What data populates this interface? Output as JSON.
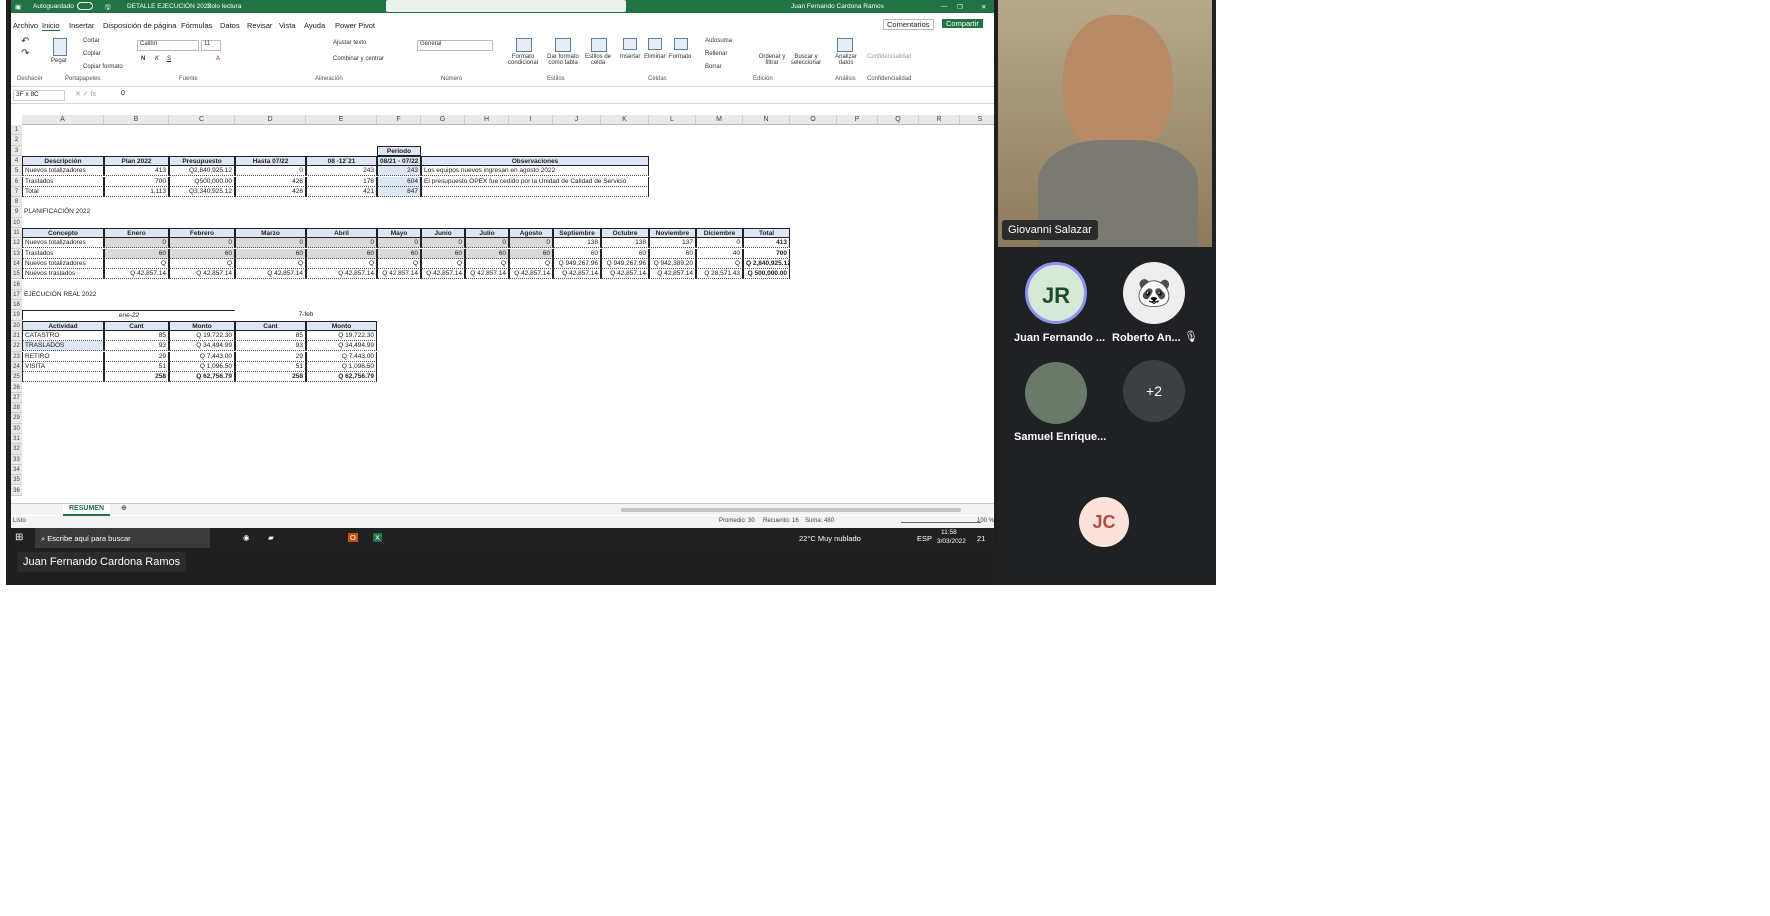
{
  "window": {
    "autosave": "Autoguardado",
    "file": "DETALLE EJECUCIÓN 2022",
    "mode": "Solo lectura",
    "user": "Juan Fernando Cardona Ramos"
  },
  "menu": [
    "Archivo",
    "Inicio",
    "Insertar",
    "Disposición de página",
    "Fórmulas",
    "Datos",
    "Revisar",
    "Vista",
    "Ayuda",
    "Power Pivot"
  ],
  "menu_right": {
    "comments": "Comentarios",
    "share": "Compartir"
  },
  "ribbon": {
    "cut": "Cortar",
    "copy": "Copiar",
    "paste": "Pegar",
    "format_painter": "Copiar formato",
    "font": "Calibri",
    "size": "11",
    "wrap": "Ajustar texto",
    "merge": "Combinar y centrar",
    "numformat": "General",
    "cond": "Formato condicional",
    "table": "Dar formato como tabla",
    "styles": "Estilos de celda",
    "insert": "Insertar",
    "delete": "Eliminar",
    "format": "Formato",
    "autosum": "Autosuma",
    "fill": "Rellenar",
    "clear": "Borrar",
    "sort": "Ordenar y filtrar",
    "find": "Buscar y seleccionar",
    "analyze": "Analizar datos",
    "conf": "Confidencialidad",
    "groups": [
      "Deshacer",
      "Portapapeles",
      "Fuente",
      "Alineación",
      "Número",
      "Estilos",
      "Celdas",
      "Edición",
      "Análisis",
      "Confidencialidad"
    ]
  },
  "formula": {
    "namebox": "3F x 8C",
    "value": "0"
  },
  "columns": [
    "A",
    "B",
    "C",
    "D",
    "E",
    "F",
    "G",
    "H",
    "I",
    "J",
    "K",
    "L",
    "M",
    "N",
    "O",
    "P",
    "Q",
    "R",
    "S"
  ],
  "rows": [
    "1",
    "2",
    "3",
    "4",
    "5",
    "6",
    "7",
    "8",
    "9",
    "10",
    "11",
    "12",
    "13",
    "14",
    "15",
    "16",
    "17",
    "18",
    "19",
    "20",
    "21",
    "22",
    "23",
    "24",
    "25",
    "26",
    "27",
    "28",
    "29",
    "30",
    "31",
    "32",
    "33",
    "34",
    "35",
    "36"
  ],
  "table1": {
    "periodo": "Período",
    "headers": [
      "Descripción",
      "Plan 2022",
      "Presupuesto",
      "Hasta 07/22",
      "08 -12´21",
      "08/21 - 07/22",
      "Observaciones"
    ],
    "rows": [
      [
        "Nuevos totalizadores",
        "413",
        "Q2,840,925.12",
        "0",
        "243",
        "243",
        "Los equipos nuevos ingresan en agosto 2022"
      ],
      [
        "Traslados",
        "700",
        "Q500,000.00",
        "426",
        "178",
        "604",
        "El presupuesto OPEX fue cedido por la Unidad de Calidad de Servicio"
      ],
      [
        "Total",
        "1,113",
        "Q3,340,925.12",
        "426",
        "421",
        "847",
        ""
      ]
    ]
  },
  "plan_title": "PLANIFICACIÓN 2022",
  "table2": {
    "headers": [
      "Concepto",
      "Enero",
      "Febrero",
      "Marzo",
      "Abril",
      "Mayo",
      "Junio",
      "Julio",
      "Agosto",
      "Septiembre",
      "Octubre",
      "Noviembre",
      "Diciembre",
      "Total"
    ],
    "rows": [
      [
        "Nuevos totalizadores",
        "0",
        "0",
        "0",
        "0",
        "0",
        "0",
        "0",
        "0",
        "138",
        "138",
        "137",
        "0",
        "413"
      ],
      [
        "Traslados",
        "60",
        "60",
        "60",
        "60",
        "60",
        "60",
        "60",
        "60",
        "60",
        "60",
        "60",
        "40",
        "700"
      ],
      [
        "Nuevos totalizadores",
        "Q",
        "Q",
        "Q",
        "Q",
        "Q",
        "Q",
        "Q",
        "Q",
        "Q 949,267.96",
        "Q 949,267.96",
        "Q 942,389.20",
        "Q",
        "Q 2,840,925.12"
      ],
      [
        "Nuevos traslados",
        "Q 42,857.14",
        "Q 42,857.14",
        "Q 42,857.14",
        "Q 42,857.14",
        "Q 42,857.14",
        "Q 42,857.14",
        "Q 42,857.14",
        "Q 42,857.14",
        "Q 42,857.14",
        "Q 42,857.14",
        "Q 42,857.14",
        "Q 28,571.43",
        "Q 500,000.00"
      ]
    ]
  },
  "exec_title": "EJECUCIÓN REAL 2022",
  "table3": {
    "month1": "ene-22",
    "month2": "7-feb",
    "headers": [
      "Actividad",
      "Cant",
      "Monto",
      "Cant",
      "Monto"
    ],
    "rows": [
      [
        "CATASTRO",
        "85",
        "Q 19,722.30",
        "85",
        "Q 19,722.30"
      ],
      [
        "TRASLADOS",
        "93",
        "Q 34,494.99",
        "93",
        "Q 34,494.99"
      ],
      [
        "RETIRO",
        "29",
        "Q 7,443.00",
        "29",
        "Q 7,443.00"
      ],
      [
        "VISITA",
        "51",
        "Q 1,096.50",
        "51",
        "Q 1,096.50"
      ],
      [
        "",
        "258",
        "Q 62,756.79",
        "258",
        "Q 62,756.79"
      ]
    ]
  },
  "sheet_tab": "RESUMEN",
  "status": {
    "ready": "Listo",
    "avg": "Promedio: 30",
    "count": "Recuento: 16",
    "sum": "Suma: 480",
    "zoom": "100 %"
  },
  "taskbar": {
    "search": "Escribe aquí para buscar",
    "weather": "22°C Muy nublado",
    "lang": "ESP",
    "time": "11:58",
    "date": "3/03/2022",
    "notif": "21"
  },
  "presenter": "Juan Fernando Cardona Ramos",
  "participants": {
    "video_name": "Giovanni Salazar",
    "p1": "Juan Fernando ...",
    "p1_initials": "JR",
    "p2": "Roberto An...",
    "p3": "Samuel Enrique...",
    "more": "+2",
    "p4_initials": "JC"
  },
  "colors": {
    "excel_green": "#217346",
    "header_fill": "#dde6f3",
    "teams_bg": "#202124"
  }
}
